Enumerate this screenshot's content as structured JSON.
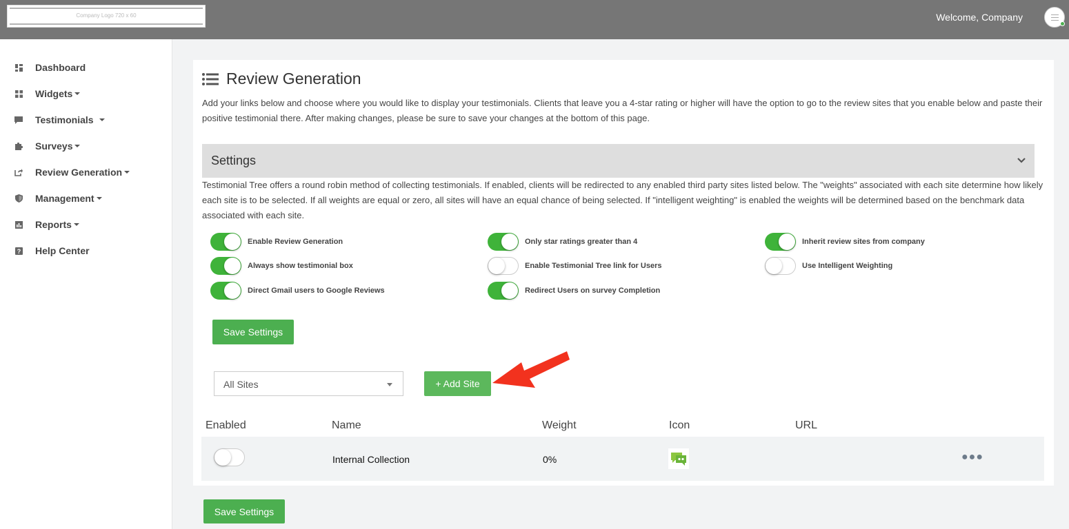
{
  "header": {
    "logo_text": "Company Logo 720 x 60",
    "welcome": "Welcome, Company"
  },
  "sidebar": {
    "items": [
      {
        "label": "Dashboard",
        "icon": "dashboard-icon",
        "dropdown": false
      },
      {
        "label": "Widgets",
        "icon": "widgets-icon",
        "dropdown": true
      },
      {
        "label": "Testimonials",
        "icon": "comment-icon",
        "dropdown": true
      },
      {
        "label": "Surveys",
        "icon": "puzzle-icon",
        "dropdown": true
      },
      {
        "label": "Review Generation",
        "icon": "share-icon",
        "dropdown": true
      },
      {
        "label": "Management",
        "icon": "shield-icon",
        "dropdown": true
      },
      {
        "label": "Reports",
        "icon": "report-icon",
        "dropdown": true
      },
      {
        "label": "Help Center",
        "icon": "help-icon",
        "dropdown": false
      }
    ]
  },
  "main": {
    "title": "Review Generation",
    "intro": "Add your links below and choose where you would like to display your testimonials. Clients that leave you a 4-star rating or higher will have the option to go to the review sites that you enable below and paste their positive testimonial there. After making changes, please be sure to save your changes at the bottom of this page.",
    "settings": {
      "heading": "Settings",
      "description": "Testimonial Tree offers a round robin method of collecting testimonials. If enabled, clients will be redirected to any enabled third party sites listed below. The \"weights\" associated with each site determine how likely each site is to be selected. If all weights are equal or zero, all sites will have an equal chance of being selected. If \"intelligent weighting\" is enabled the weights will be determined based on the benchmark data associated with each site.",
      "toggles": [
        {
          "label": "Enable Review Generation",
          "on": true
        },
        {
          "label": "Only star ratings greater than 4",
          "on": true
        },
        {
          "label": "Inherit review sites from company",
          "on": true
        },
        {
          "label": "Always show testimonial box",
          "on": true
        },
        {
          "label": "Enable Testimonial Tree link for Users",
          "on": false
        },
        {
          "label": "Use Intelligent Weighting",
          "on": false
        },
        {
          "label": "Direct Gmail users to Google Reviews",
          "on": true
        },
        {
          "label": "Redirect Users on survey Completion",
          "on": true
        }
      ],
      "save_label": "Save Settings"
    },
    "filter": {
      "selected": "All Sites",
      "add_label": "+ Add Site"
    },
    "table": {
      "headers": [
        "Enabled",
        "Name",
        "Weight",
        "Icon",
        "URL"
      ],
      "rows": [
        {
          "enabled": false,
          "name": "Internal Collection",
          "weight": "0%",
          "icon": "chat-bubbles-icon",
          "url": ""
        }
      ]
    },
    "bottom_save_label": "Save Settings"
  },
  "colors": {
    "accent": "#4caf50",
    "toggle_on": "#3fb33a",
    "topbar": "#767676",
    "annotation_arrow": "#f2321e"
  }
}
